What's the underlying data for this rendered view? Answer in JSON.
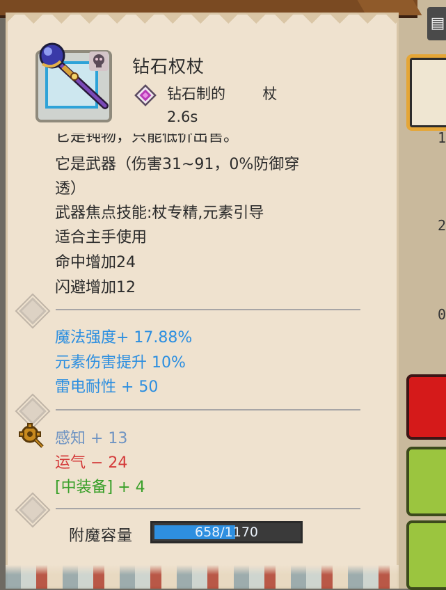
{
  "item": {
    "title": "钻石权杖",
    "subtitle": "钻石制的        杖",
    "speed": "2.6s"
  },
  "description": {
    "clipped_line": "它是钝物，只能低价出售。",
    "weapon_line_1": "它是武器（伤害31~91，0%防御穿",
    "weapon_line_2": "透）",
    "skill_line": "武器焦点技能:杖专精,元素引导",
    "hand_line": "适合主手使用",
    "hit_line": "命中增加24",
    "dodge_line": "闪避增加12"
  },
  "magic_stats": {
    "magic_power": "魔法强度+ 17.88%",
    "element_damage": "元素伤害提升 10%",
    "thunder_resist": "雷电耐性 + 50"
  },
  "attributes": {
    "perception": "感知 + 13",
    "luck": "运气 − 24",
    "medium_armor": "[中装备] + 4"
  },
  "enchant": {
    "label": "附魔容量",
    "value": "658/1170",
    "current": 658,
    "max": 1170
  },
  "right_panel": {
    "digits": [
      "1",
      "2",
      "0"
    ]
  },
  "colors": {
    "parchment": "#efe2cf",
    "blue_stat": "#2b8ee0",
    "perception": "#6e93c2",
    "negative": "#d43a3a",
    "positive": "#3aa02a",
    "bar_fill": "#2e8fe0"
  },
  "icons": {
    "item": "diamond-staff-icon",
    "badge": "skull-icon",
    "material": "purple-gem-icon",
    "attribute": "gear-icon"
  }
}
